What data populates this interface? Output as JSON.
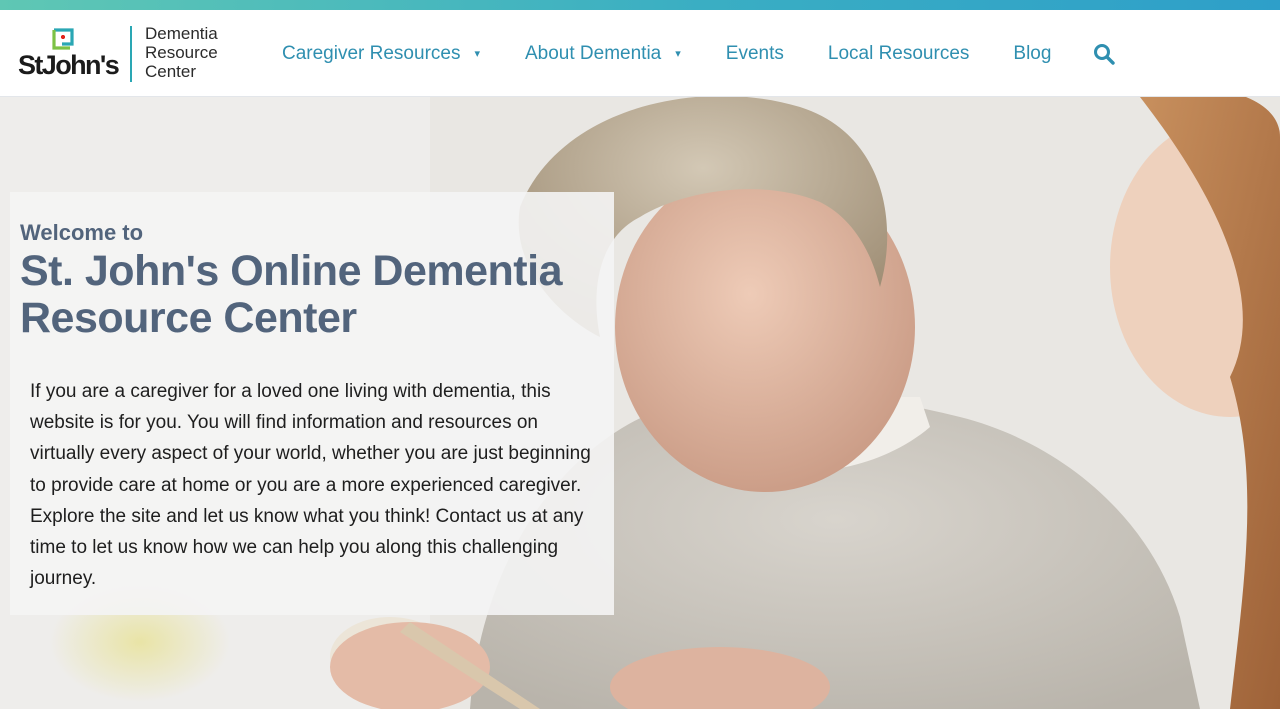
{
  "brand": {
    "wordmark": "StJohn's",
    "subtitle_lines": [
      "Dementia",
      "Resource",
      "Center"
    ],
    "accent_color": "#2aa7b4",
    "mark_colors": [
      "#2aa7b4",
      "#e2231a",
      "#7cc245"
    ]
  },
  "nav": {
    "items": [
      {
        "label": "Caregiver Resources",
        "has_dropdown": true,
        "caret": "▾"
      },
      {
        "label": "About Dementia",
        "has_dropdown": true,
        "caret": "▾"
      },
      {
        "label": "Events",
        "has_dropdown": false
      },
      {
        "label": "Local Resources",
        "has_dropdown": false
      },
      {
        "label": "Blog",
        "has_dropdown": false
      }
    ],
    "search_icon": "search-icon",
    "link_color": "#2f8fb0"
  },
  "hero": {
    "kicker": "Welcome to",
    "title": "St. John's Online Dementia Resource Center",
    "body": "If you are a caregiver for a loved one living with dementia, this website is for you. You will find information and resources on virtually every aspect of your world, whether you are just beginning to provide care at home or you are a more experienced caregiver. Explore the site and let us know what you think! Contact us at any time to let us know how we can help you along this challenging journey.",
    "heading_color": "#52647c"
  }
}
